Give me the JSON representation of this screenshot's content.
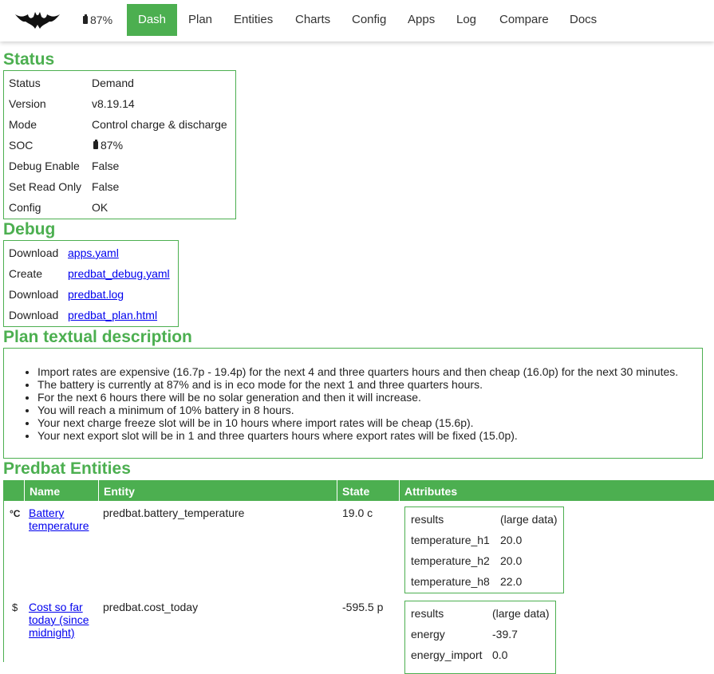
{
  "nav": {
    "battery": "87%",
    "items": [
      "Dash",
      "Plan",
      "Entities",
      "Charts",
      "Config",
      "Apps",
      "Log",
      "Compare",
      "Docs"
    ],
    "active": "Dash"
  },
  "status": {
    "heading": "Status",
    "rows": [
      {
        "key": "Status",
        "value": "Demand"
      },
      {
        "key": "Version",
        "value": "v8.19.14"
      },
      {
        "key": "Mode",
        "value": "Control charge & discharge"
      },
      {
        "key": "SOC",
        "value": "87%"
      },
      {
        "key": "Debug Enable",
        "value": "False"
      },
      {
        "key": "Set Read Only",
        "value": "False"
      },
      {
        "key": "Config",
        "value": "OK"
      }
    ]
  },
  "debug": {
    "heading": "Debug",
    "rows": [
      {
        "action": "Download",
        "link": "apps.yaml"
      },
      {
        "action": "Create",
        "link": "predbat_debug.yaml"
      },
      {
        "action": "Download",
        "link": "predbat.log"
      },
      {
        "action": "Download",
        "link": "predbat_plan.html"
      }
    ]
  },
  "plan": {
    "heading": "Plan textual description",
    "lines": [
      "Import rates are expensive (16.7p - 19.4p) for the next 4 and three quarters hours and then cheap (16.0p) for the next 30 minutes.",
      "The battery is currently at 87% and is in eco mode for the next 1 and three quarters hours.",
      "For the next 6 hours there will be no solar generation and then it will increase.",
      "You will reach a minimum of 10% battery in 8 hours.",
      "Your next charge freeze slot will be in 10 hours where import rates will be cheap (15.6p).",
      "Your next export slot will be in 1 and three quarters hours where export rates will be fixed (15.0p)."
    ]
  },
  "entities": {
    "heading": "Predbat Entities",
    "columns": {
      "name": "Name",
      "entity": "Entity",
      "state": "State",
      "attributes": "Attributes"
    },
    "rows": [
      {
        "icon": "°C",
        "name": "Battery temperature",
        "entity": "predbat.battery_temperature",
        "state": "19.0 c",
        "attributes": [
          {
            "k": "results",
            "v": "(large data)"
          },
          {
            "k": "temperature_h1",
            "v": "20.0"
          },
          {
            "k": "temperature_h2",
            "v": "20.0"
          },
          {
            "k": "temperature_h8",
            "v": "22.0"
          }
        ]
      },
      {
        "icon": "$",
        "name": "Cost so far today (since midnight)",
        "entity": "predbat.cost_today",
        "state": "-595.5 p",
        "attributes": [
          {
            "k": "results",
            "v": "(large data)"
          },
          {
            "k": "energy",
            "v": "-39.7"
          },
          {
            "k": "energy_import",
            "v": "0.0"
          }
        ]
      }
    ]
  }
}
